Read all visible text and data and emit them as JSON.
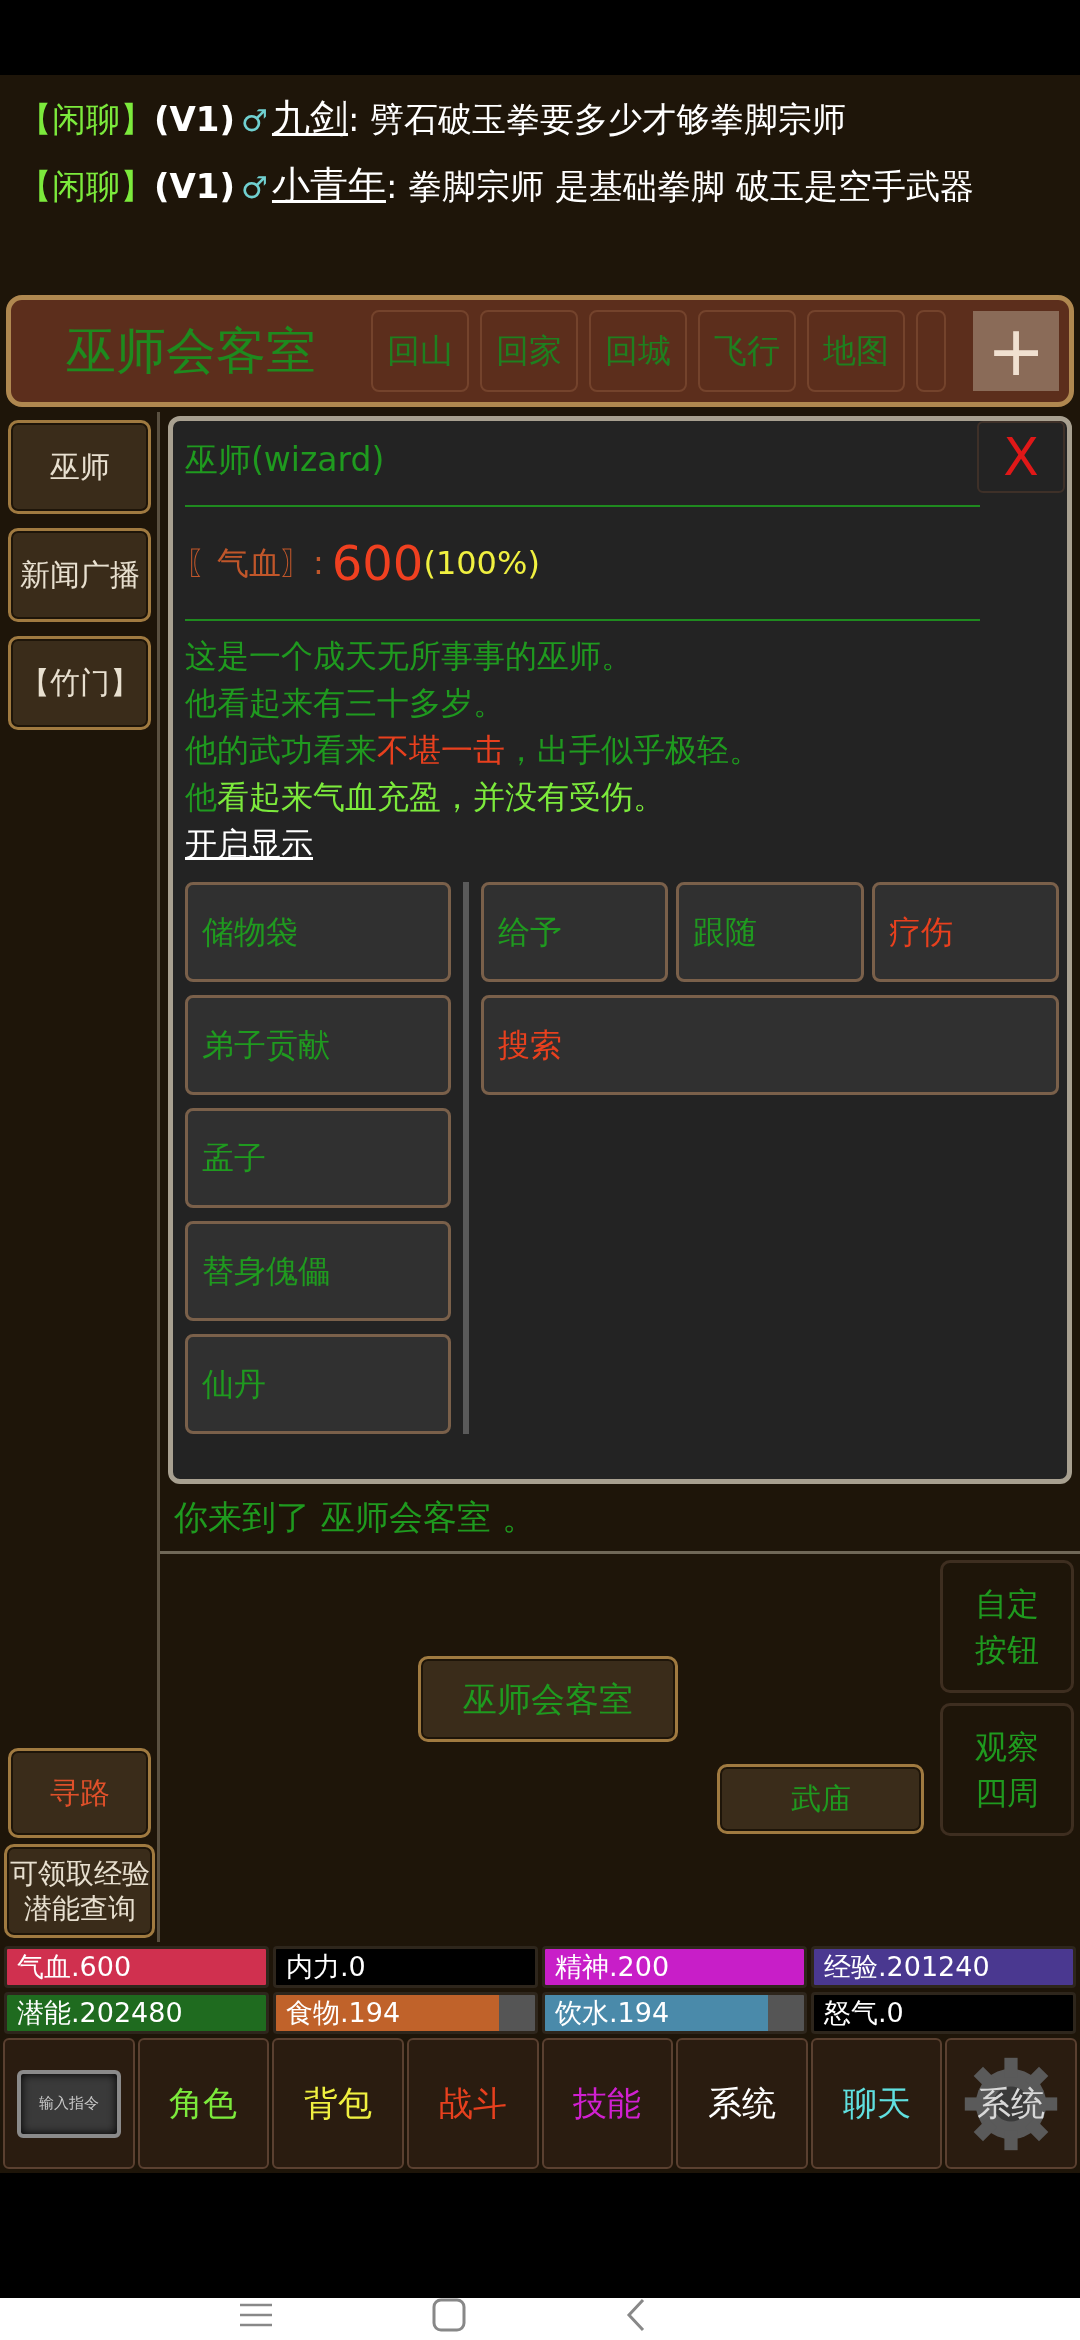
{
  "chat": [
    {
      "channel": "【闲聊】",
      "vip": "(V1)",
      "gender": "♂",
      "name": "九剑",
      "message": ": 劈石破玉拳要多少才够拳脚宗师"
    },
    {
      "channel": "【闲聊】",
      "vip": "(V1)",
      "gender": "♂",
      "name": "小青年",
      "message": ": 拳脚宗师  是基础拳脚  破玉是空手武器"
    }
  ],
  "location_bar": {
    "title": "巫师会客室",
    "tabs": [
      "回山",
      "回家",
      "回城",
      "飞行",
      "地图"
    ],
    "add": "+"
  },
  "sidebar": {
    "top": [
      "巫师",
      "新闻广播",
      "【竹门】"
    ],
    "bottom": [
      {
        "label": "寻路",
        "color": "#e0502a"
      },
      {
        "label": "可领取经验潜能查询",
        "color": "#e8e0d0"
      }
    ]
  },
  "dialog": {
    "title": "巫师(wizard)",
    "close": "X",
    "hp": {
      "label": "〖气血〗:",
      "value": "600",
      "percent": "(100%)"
    },
    "description": [
      [
        {
          "text": "这是一个成天无所事事的巫师。",
          "color": "#1f9a1f"
        }
      ],
      [
        {
          "text": "他看起来有三十多岁。",
          "color": "#1f9a1f"
        }
      ],
      [
        {
          "text": "他的武功看来",
          "color": "#1f9a1f"
        },
        {
          "text": "不堪一击",
          "color": "#e8401e"
        },
        {
          "text": "，出手似乎极轻。",
          "color": "#1f9a1f"
        }
      ],
      [
        {
          "text": "他",
          "color": "#1f9a1f"
        },
        {
          "text": "看起来气血充盈，并没有受伤。",
          "color": "#7cea3c"
        }
      ]
    ],
    "link": "开启显示",
    "left_actions": [
      {
        "label": "储物袋",
        "color": "#1f9a1f"
      },
      {
        "label": "弟子贡献",
        "color": "#1f9a1f"
      },
      {
        "label": "孟子",
        "color": "#1f9a1f"
      },
      {
        "label": "替身傀儡",
        "color": "#1f9a1f"
      },
      {
        "label": "仙丹",
        "color": "#1f9a1f"
      }
    ],
    "right_actions": [
      {
        "label": "给予",
        "color": "#1f9a1f"
      },
      {
        "label": "跟随",
        "color": "#1f9a1f"
      },
      {
        "label": "疗伤",
        "color": "#e8401e"
      },
      {
        "label": "搜索",
        "color": "#e8401e"
      }
    ]
  },
  "arrival": "你来到了 巫师会客室 。",
  "map": {
    "current": "巫师会客室",
    "exits": [
      "武庙"
    ],
    "side_buttons": [
      "自定按钮",
      "观察四周"
    ]
  },
  "stats": [
    {
      "label": "气血.600",
      "color": "#d0304f",
      "level": 1
    },
    {
      "label": "内力.0",
      "color": "#000000",
      "level": 1
    },
    {
      "label": "精神.200",
      "color": "#c81ec8",
      "level": 1
    },
    {
      "label": "经验.201240",
      "color": "#4a3890",
      "level": 1
    },
    {
      "label": "潜能.202480",
      "color": "#1f6b1f",
      "level": 1
    },
    {
      "label": "食物.194",
      "color": "#c0622a",
      "level": 0.86
    },
    {
      "label": "饮水.194",
      "color": "#4a8aaa",
      "level": 0.86
    },
    {
      "label": "怒气.0",
      "color": "#000000",
      "level": 1
    }
  ],
  "menu": [
    {
      "kind": "image",
      "label": "输入指令",
      "color": "#3a3a3a"
    },
    {
      "kind": "text",
      "label": "角色",
      "color": "#7cea3c"
    },
    {
      "kind": "text",
      "label": "背包",
      "color": "#f0f040"
    },
    {
      "kind": "text",
      "label": "战斗",
      "color": "#e8401e"
    },
    {
      "kind": "text",
      "label": "技能",
      "color": "#d020d0"
    },
    {
      "kind": "text",
      "label": "系统",
      "color": "#ffffff"
    },
    {
      "kind": "text",
      "label": "聊天",
      "color": "#60e0e0"
    },
    {
      "kind": "gear",
      "label": "系统",
      "color": "#d8d8d8"
    }
  ]
}
